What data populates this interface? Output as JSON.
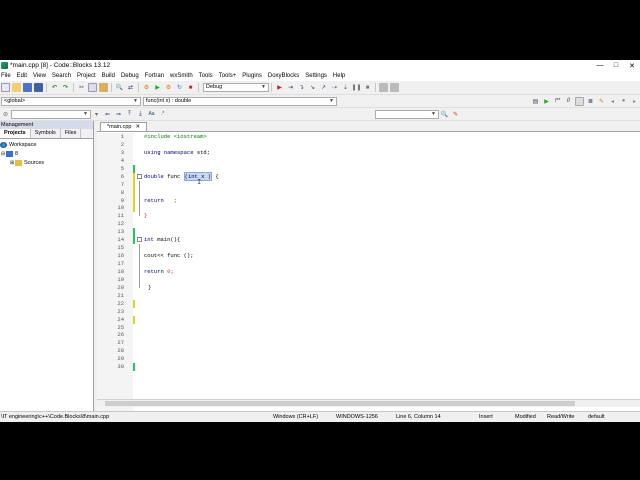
{
  "window": {
    "title": "*main.cpp [8] - Code::Blocks 13.12",
    "controls": [
      "—",
      "□",
      "✕"
    ]
  },
  "menu": [
    "File",
    "Edit",
    "View",
    "Search",
    "Project",
    "Build",
    "Debug",
    "Fortran",
    "wxSmith",
    "Tools",
    "Tools+",
    "Plugins",
    "DoxyBlocks",
    "Settings",
    "Help"
  ],
  "toolbar": {
    "build_target": "Debug",
    "scope": "<global>",
    "function": "func(int x) : double"
  },
  "management": {
    "header": "Management",
    "tabs": [
      "Projects",
      "Symbols",
      "Files"
    ],
    "tree": {
      "workspace": "Workspace",
      "project": "8",
      "folder": "Sources"
    }
  },
  "editor": {
    "tab_label": "*main.cpp",
    "tab_close": "✕",
    "line_numbers": [
      "1",
      "2",
      "3",
      "4",
      "5",
      "6",
      "7",
      "8",
      "9",
      "10",
      "11",
      "12",
      "13",
      "14",
      "15",
      "16",
      "17",
      "18",
      "19",
      "20",
      "21",
      "22",
      "23",
      "24",
      "25",
      "26",
      "27",
      "28",
      "29",
      "30"
    ],
    "code": {
      "l1": "#include <iostream>",
      "l3_kw": "using namespace",
      "l3_rest": " std;",
      "l6_kw": "double",
      "l6_a": " func ",
      "l6_sel_open": "(",
      "l6_sel_kw": "int",
      "l6_sel_rest": " x )",
      "l6_b": " {",
      "l9_kw": "return",
      "l9_rest": "   ;",
      "l11": "}",
      "l13_kw": "int",
      "l13_rest": " main(){",
      "l16": "cout<< func ();",
      "l18_kw": "return",
      "l18_num": "0",
      "l18_rest": ";",
      "l20": "}"
    }
  },
  "status": {
    "path": "\\IT engineering\\c++\\Code.Blocks\\8\\main.cpp",
    "eol": "Windows (CR+LF)",
    "encoding": "WINDOWS-1256",
    "position": "Line 6, Column 14",
    "mode": "Insert",
    "modified": "Modified",
    "access": "Read/Write",
    "profile": "default"
  }
}
